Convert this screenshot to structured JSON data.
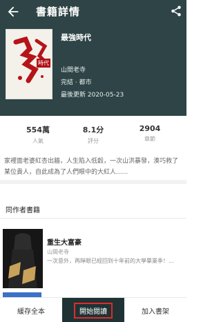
{
  "header": {
    "title": "書籍詳情"
  },
  "book": {
    "cover_text": "最強",
    "cover_tag": "時代",
    "title": "最強時代",
    "author": "山間老寺",
    "status": "完結 · 都市",
    "last_updated": "最後更新 2020-05-23"
  },
  "stats": [
    {
      "value": "554萬",
      "label": "人氣"
    },
    {
      "value": "8.1分",
      "label": "評分"
    },
    {
      "value": "2904",
      "label": "章節"
    }
  ],
  "description": "家裡面老婆紅杏出牆，人生陷入低穀，一次山洪暴發，湊巧救了某位貴人，自此成為了人們眼中的大紅人......",
  "same_author": {
    "section_title": "同作者書籍",
    "items": [
      {
        "title": "重生大富豪",
        "author": "山間老寺",
        "summary": "一次意外，再睜眼已經回到十年前的大學畢業季！..."
      }
    ]
  },
  "bottom_bar": {
    "cache_label": "緩存全本",
    "read_label": "開始閱讀",
    "add_label": "加入書架"
  },
  "colors": {
    "header_bg": "#2e4446",
    "read_btn_bg": "#1f3335",
    "highlight": "#e12a2a"
  }
}
